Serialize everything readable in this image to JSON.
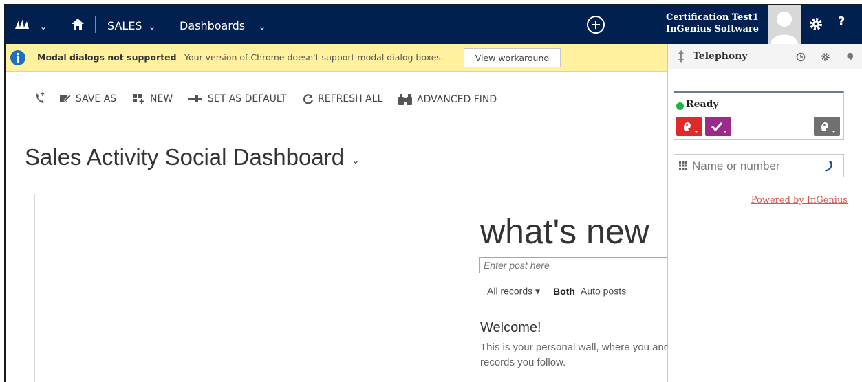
{
  "nav": {
    "module": "SALES",
    "area": "Dashboards",
    "user_name": "Certification Test1",
    "org_name": "InGenius Software",
    "help_label": "?"
  },
  "notice": {
    "title": "Modal dialogs not supported",
    "message": "Your version of Chrome doesn't support modal dialog boxes.",
    "button": "View workaround"
  },
  "commands": {
    "save_as": "SAVE AS",
    "new": "NEW",
    "set_default": "SET AS DEFAULT",
    "refresh_all": "REFRESH ALL",
    "advanced_find": "ADVANCED FIND"
  },
  "dashboard": {
    "title": "Sales Activity Social Dashboard"
  },
  "whats_new": {
    "title": "what's new",
    "post_placeholder": "Enter post here",
    "filter_records": "All records",
    "filter_both": "Both",
    "filter_auto": "Auto posts",
    "welcome_title": "Welcome!",
    "welcome_text": "This is your personal wall, where you and records you follow."
  },
  "telephony": {
    "title": "Telephony",
    "status": "Ready",
    "status_color": "#22b24c",
    "dial_placeholder": "Name or number",
    "powered_by": "Powered by InGenius"
  },
  "colors": {
    "nav_bg": "#002050",
    "notice_bg": "#fff19e",
    "btn_red": "#e02a2a",
    "btn_purple": "#9b2a8a",
    "btn_gray": "#707070"
  }
}
